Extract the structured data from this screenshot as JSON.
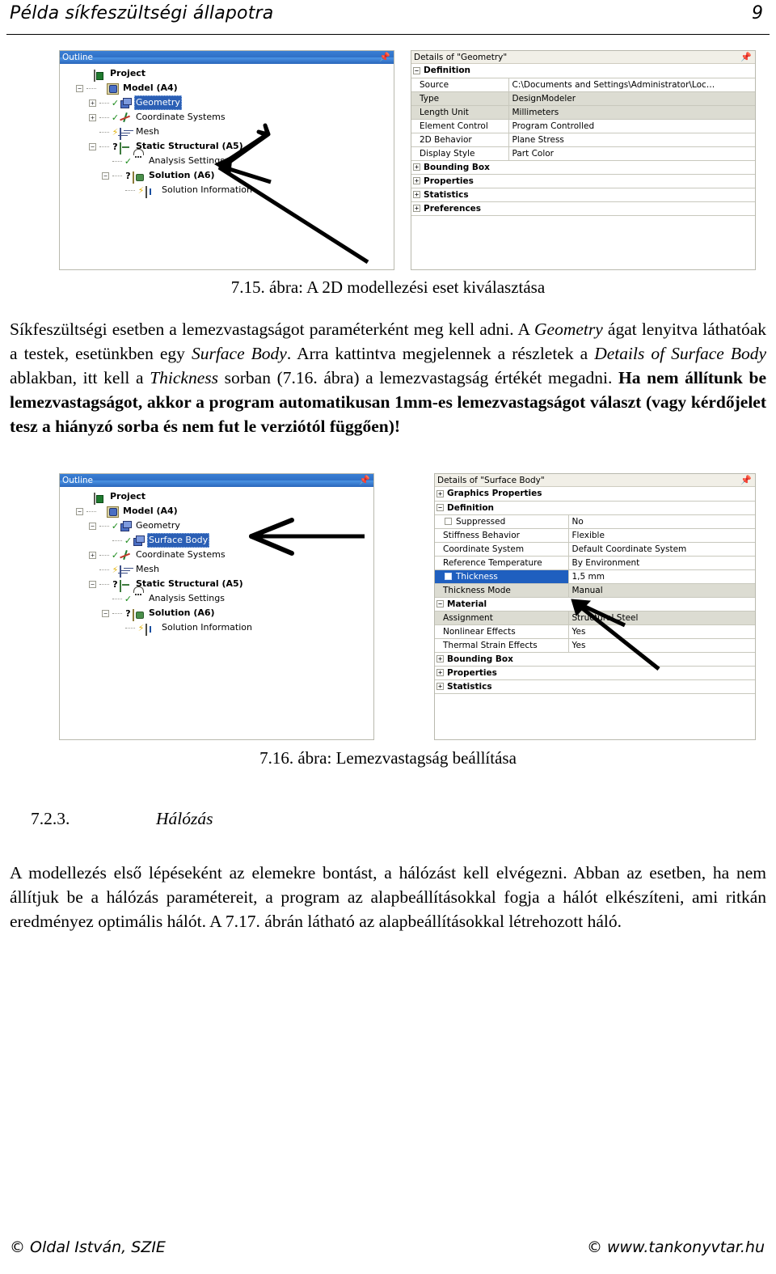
{
  "header": {
    "title": "Példa síkfeszültségi állapotra",
    "page_number": "9"
  },
  "figure1": {
    "outline": {
      "panel_title": "Outline",
      "pin_icon": "pin-icon",
      "nodes": [
        {
          "label": "Project",
          "icon": "project-icon",
          "bold": true,
          "selected": false,
          "expander": "none",
          "status": "none",
          "depth": 0
        },
        {
          "label": "Model (A4)",
          "icon": "model-icon",
          "bold": true,
          "selected": false,
          "expander": "collapse",
          "status": "none",
          "depth": 1
        },
        {
          "label": "Geometry",
          "icon": "cube-icon",
          "bold": false,
          "selected": true,
          "expander": "expand",
          "status": "check",
          "depth": 2
        },
        {
          "label": "Coordinate Systems",
          "icon": "axes-icon",
          "bold": false,
          "selected": false,
          "expander": "expand",
          "status": "check",
          "depth": 2
        },
        {
          "label": "Mesh",
          "icon": "mesh-icon",
          "bold": false,
          "selected": false,
          "expander": "none",
          "status": "bolt",
          "depth": 2
        },
        {
          "label": "Static Structural (A5)",
          "icon": "folder-icon",
          "bold": true,
          "selected": false,
          "expander": "collapse",
          "status": "query",
          "depth": 2
        },
        {
          "label": "Analysis Settings",
          "icon": "analysis-icon",
          "bold": false,
          "selected": false,
          "expander": "none",
          "status": "check",
          "depth": 3
        },
        {
          "label": "Solution (A6)",
          "icon": "solution-icon",
          "bold": true,
          "selected": false,
          "expander": "collapse",
          "status": "query",
          "depth": 3
        },
        {
          "label": "Solution Information",
          "icon": "solinfo-icon",
          "bold": false,
          "selected": false,
          "expander": "none",
          "status": "bolt",
          "depth": 4
        }
      ]
    },
    "details": {
      "panel_title": "Details of \"Geometry\"",
      "pin_icon": "pin-icon",
      "rows": [
        {
          "kind": "section",
          "label": "Definition",
          "state": "collapse",
          "value": ""
        },
        {
          "kind": "prop",
          "label": "Source",
          "value": "C:\\Documents and Settings\\Administrator\\Loc…",
          "shaded": false
        },
        {
          "kind": "prop",
          "label": "Type",
          "value": "DesignModeler",
          "shaded": true
        },
        {
          "kind": "prop",
          "label": "Length Unit",
          "value": "Millimeters",
          "shaded": true
        },
        {
          "kind": "prop",
          "label": "Element Control",
          "value": "Program Controlled",
          "shaded": false
        },
        {
          "kind": "prop",
          "label": "2D Behavior",
          "value": "Plane Stress",
          "shaded": false
        },
        {
          "kind": "prop",
          "label": "Display Style",
          "value": "Part Color",
          "shaded": false
        },
        {
          "kind": "section",
          "label": "Bounding Box",
          "state": "expand",
          "value": ""
        },
        {
          "kind": "section",
          "label": "Properties",
          "state": "expand",
          "value": ""
        },
        {
          "kind": "section",
          "label": "Statistics",
          "state": "expand",
          "value": ""
        },
        {
          "kind": "section",
          "label": "Preferences",
          "state": "expand",
          "value": ""
        }
      ]
    },
    "caption": "7.15. ábra: A 2D modellezési eset kiválasztása"
  },
  "paragraph1": {
    "html": "Síkfeszültségi esetben a lemezvastagságot paraméterként meg kell adni. A <i>Geometry</i> ágat lenyitva láthatóak a testek, esetünkben egy <i>Surface Body</i>. Arra kattintva megjelennek a részletek a <i>Details of Surface Body</i> ablakban, itt kell a <i>Thickness</i> sorban (7.16. ábra) a lemezvastagság értékét megadni. <b>Ha nem állítunk be lemezvastagságot, akkor a program automatikusan 1mm-es lemezvastagságot választ (vagy kérdőjelet tesz a hiányzó sorba és nem fut le verziótól függően)!</b>"
  },
  "figure2": {
    "outline": {
      "panel_title": "Outline",
      "pin_icon": "pin-icon",
      "nodes": [
        {
          "label": "Project",
          "icon": "project-icon",
          "bold": true,
          "selected": false,
          "expander": "none",
          "status": "none",
          "depth": 0
        },
        {
          "label": "Model (A4)",
          "icon": "model-icon",
          "bold": true,
          "selected": false,
          "expander": "collapse",
          "status": "none",
          "depth": 1
        },
        {
          "label": "Geometry",
          "icon": "cube-icon",
          "bold": false,
          "selected": false,
          "expander": "collapse",
          "status": "check",
          "depth": 2
        },
        {
          "label": "Surface Body",
          "icon": "cube-icon",
          "bold": false,
          "selected": true,
          "expander": "none",
          "status": "check",
          "depth": 3
        },
        {
          "label": "Coordinate Systems",
          "icon": "axes-icon",
          "bold": false,
          "selected": false,
          "expander": "expand",
          "status": "check",
          "depth": 2
        },
        {
          "label": "Mesh",
          "icon": "mesh-icon",
          "bold": false,
          "selected": false,
          "expander": "none",
          "status": "bolt",
          "depth": 2
        },
        {
          "label": "Static Structural (A5)",
          "icon": "folder-icon",
          "bold": true,
          "selected": false,
          "expander": "collapse",
          "status": "query",
          "depth": 2
        },
        {
          "label": "Analysis Settings",
          "icon": "analysis-icon",
          "bold": false,
          "selected": false,
          "expander": "none",
          "status": "check",
          "depth": 3
        },
        {
          "label": "Solution (A6)",
          "icon": "solution-icon",
          "bold": true,
          "selected": false,
          "expander": "collapse",
          "status": "query",
          "depth": 3
        },
        {
          "label": "Solution Information",
          "icon": "solinfo-icon",
          "bold": false,
          "selected": false,
          "expander": "none",
          "status": "bolt",
          "depth": 4
        }
      ]
    },
    "details": {
      "panel_title": "Details of \"Surface Body\"",
      "pin_icon": "pin-icon",
      "rows": [
        {
          "kind": "section",
          "label": "Graphics Properties",
          "state": "expand",
          "value": ""
        },
        {
          "kind": "section",
          "label": "Definition",
          "state": "collapse",
          "value": ""
        },
        {
          "kind": "check",
          "label": "Suppressed",
          "value": "No",
          "shaded": false
        },
        {
          "kind": "prop",
          "label": "Stiffness Behavior",
          "value": "Flexible",
          "shaded": false
        },
        {
          "kind": "prop",
          "label": "Coordinate System",
          "value": "Default Coordinate System",
          "shaded": false
        },
        {
          "kind": "prop",
          "label": "Reference Temperature",
          "value": "By Environment",
          "shaded": false
        },
        {
          "kind": "hilite",
          "label": "Thickness",
          "value": "1,5 mm",
          "shaded": false
        },
        {
          "kind": "prop",
          "label": "Thickness Mode",
          "value": "Manual",
          "shaded": true
        },
        {
          "kind": "section",
          "label": "Material",
          "state": "collapse",
          "value": ""
        },
        {
          "kind": "prop",
          "label": "Assignment",
          "value": "Structural Steel",
          "shaded": true
        },
        {
          "kind": "prop",
          "label": "Nonlinear Effects",
          "value": "Yes",
          "shaded": false
        },
        {
          "kind": "prop",
          "label": "Thermal Strain Effects",
          "value": "Yes",
          "shaded": false
        },
        {
          "kind": "section",
          "label": "Bounding Box",
          "state": "expand",
          "value": ""
        },
        {
          "kind": "section",
          "label": "Properties",
          "state": "expand",
          "value": ""
        },
        {
          "kind": "section",
          "label": "Statistics",
          "state": "expand",
          "value": ""
        }
      ]
    },
    "caption": "7.16. ábra: Lemezvastagság beállítása"
  },
  "section": {
    "number": "7.2.3.",
    "title": "Hálózás"
  },
  "paragraph2": {
    "html": "A modellezés első lépéseként az elemekre bontást, a hálózást kell elvégezni. Abban az esetben, ha nem állítjuk be a hálózás paramétereit, a program az alapbeállításokkal fogja a hálót elkészíteni, ami ritkán eredményez optimális hálót. A 7.17. ábrán látható az alapbeállításokkal létrehozott háló."
  },
  "footer": {
    "left": "© Oldal István, SZIE",
    "right": "© www.tankonyvtar.hu"
  },
  "colors": {
    "title_blue": "#2f6fc6",
    "selection_blue": "#2b5fb5",
    "row_shade": "#dcdcd2",
    "panel_border": "#b9b9ae"
  }
}
